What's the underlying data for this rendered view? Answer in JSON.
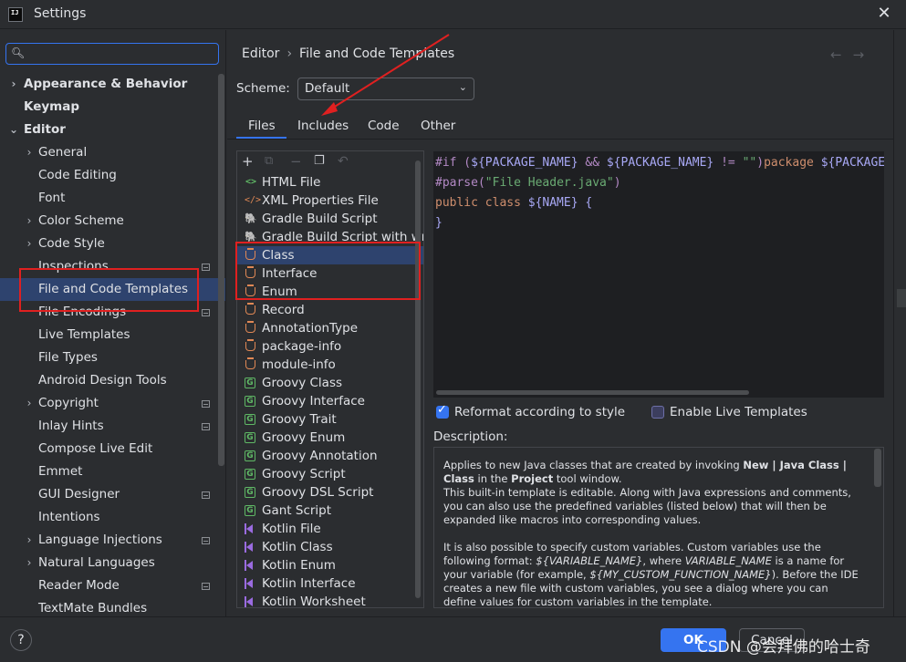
{
  "window": {
    "title": "Settings",
    "app_icon_text": "IJ"
  },
  "sidebar": {
    "search_placeholder": "",
    "items": [
      {
        "label": "Appearance & Behavior",
        "bold": true,
        "chevron": "›",
        "indent": 0
      },
      {
        "label": "Keymap",
        "bold": true,
        "chevron": "",
        "indent": 0
      },
      {
        "label": "Editor",
        "bold": true,
        "chevron": "⌄",
        "indent": 0
      },
      {
        "label": "General",
        "chevron": "›",
        "indent": 1
      },
      {
        "label": "Code Editing",
        "chevron": "",
        "indent": 1
      },
      {
        "label": "Font",
        "chevron": "",
        "indent": 1
      },
      {
        "label": "Color Scheme",
        "chevron": "›",
        "indent": 1
      },
      {
        "label": "Code Style",
        "chevron": "›",
        "indent": 1
      },
      {
        "label": "Inspections",
        "chevron": "",
        "indent": 1,
        "mark": true
      },
      {
        "label": "File and Code Templates",
        "chevron": "",
        "indent": 1,
        "selected": true
      },
      {
        "label": "File Encodings",
        "chevron": "",
        "indent": 1,
        "mark": true
      },
      {
        "label": "Live Templates",
        "chevron": "",
        "indent": 1
      },
      {
        "label": "File Types",
        "chevron": "",
        "indent": 1
      },
      {
        "label": "Android Design Tools",
        "chevron": "",
        "indent": 1
      },
      {
        "label": "Copyright",
        "chevron": "›",
        "indent": 1,
        "mark": true
      },
      {
        "label": "Inlay Hints",
        "chevron": "",
        "indent": 1,
        "mark": true
      },
      {
        "label": "Compose Live Edit",
        "chevron": "",
        "indent": 1
      },
      {
        "label": "Emmet",
        "chevron": "",
        "indent": 1
      },
      {
        "label": "GUI Designer",
        "chevron": "",
        "indent": 1,
        "mark": true
      },
      {
        "label": "Intentions",
        "chevron": "",
        "indent": 1
      },
      {
        "label": "Language Injections",
        "chevron": "›",
        "indent": 1,
        "mark": true
      },
      {
        "label": "Natural Languages",
        "chevron": "›",
        "indent": 1
      },
      {
        "label": "Reader Mode",
        "chevron": "",
        "indent": 1,
        "mark": true
      },
      {
        "label": "TextMate Bundles",
        "chevron": "",
        "indent": 1
      }
    ]
  },
  "breadcrumb": {
    "parent": "Editor",
    "separator": "›",
    "current": "File and Code Templates"
  },
  "nav": {
    "back": "←",
    "forward": "→"
  },
  "scheme": {
    "label": "Scheme:",
    "value": "Default"
  },
  "tabs": [
    {
      "label": "Files",
      "active": true
    },
    {
      "label": "Includes"
    },
    {
      "label": "Code"
    },
    {
      "label": "Other"
    }
  ],
  "toolbar": {
    "add": "+",
    "copy": "⧉",
    "remove": "−",
    "duplicate": "❐",
    "reset": "↶"
  },
  "templates": [
    {
      "name": "HTML File",
      "icon": "html-icon",
      "glyph": "<>"
    },
    {
      "name": "XML Properties File",
      "icon": "xml-icon",
      "glyph": "</>"
    },
    {
      "name": "Gradle Build Script",
      "icon": "gradle-icon",
      "glyph": "🐘"
    },
    {
      "name": "Gradle Build Script with wrapper",
      "icon": "gradle-icon",
      "glyph": "🐘"
    },
    {
      "name": "Class",
      "icon": "java-icon",
      "selected": true
    },
    {
      "name": "Interface",
      "icon": "java-icon"
    },
    {
      "name": "Enum",
      "icon": "java-icon"
    },
    {
      "name": "Record",
      "icon": "java-icon"
    },
    {
      "name": "AnnotationType",
      "icon": "java-icon"
    },
    {
      "name": "package-info",
      "icon": "java-icon"
    },
    {
      "name": "module-info",
      "icon": "java-icon"
    },
    {
      "name": "Groovy Class",
      "icon": "groovy-icon",
      "glyph": "G"
    },
    {
      "name": "Groovy Interface",
      "icon": "groovy-icon",
      "glyph": "G"
    },
    {
      "name": "Groovy Trait",
      "icon": "groovy-icon",
      "glyph": "G"
    },
    {
      "name": "Groovy Enum",
      "icon": "groovy-icon",
      "glyph": "G"
    },
    {
      "name": "Groovy Annotation",
      "icon": "groovy-icon",
      "glyph": "G"
    },
    {
      "name": "Groovy Script",
      "icon": "groovy-icon",
      "glyph": "G"
    },
    {
      "name": "Groovy DSL Script",
      "icon": "groovy-icon",
      "glyph": "G"
    },
    {
      "name": "Gant Script",
      "icon": "groovy-icon",
      "glyph": "G"
    },
    {
      "name": "Kotlin File",
      "icon": "kotlin-icon"
    },
    {
      "name": "Kotlin Class",
      "icon": "kotlin-icon"
    },
    {
      "name": "Kotlin Enum",
      "icon": "kotlin-icon"
    },
    {
      "name": "Kotlin Interface",
      "icon": "kotlin-icon"
    },
    {
      "name": "Kotlin Worksheet",
      "icon": "kotlin-icon"
    }
  ],
  "editor": {
    "lines": [
      [
        {
          "t": "#if (",
          "c": "dir"
        },
        {
          "t": "${PACKAGE_NAME}",
          "c": "var"
        },
        {
          "t": " && ",
          "c": "dir"
        },
        {
          "t": "${PACKAGE_NAME}",
          "c": "var"
        },
        {
          "t": " != ",
          "c": "dir"
        },
        {
          "t": "\"\"",
          "c": "str"
        },
        {
          "t": ")",
          "c": "dir"
        },
        {
          "t": "package ",
          "c": "kw"
        },
        {
          "t": "${PACKAGE_NAME};#end",
          "c": "var"
        }
      ],
      [
        {
          "t": "#parse(",
          "c": "dir"
        },
        {
          "t": "\"File Header.java\"",
          "c": "str"
        },
        {
          "t": ")",
          "c": "dir"
        }
      ],
      [
        {
          "t": "public class ",
          "c": "kw"
        },
        {
          "t": "${NAME}",
          "c": "var"
        },
        {
          "t": " {",
          "c": "var"
        }
      ],
      [
        {
          "t": "}",
          "c": "var"
        }
      ]
    ]
  },
  "options": {
    "reformat_label": "Reformat according to style",
    "reformat_checked": true,
    "live_templates_label": "Enable Live Templates",
    "live_templates_checked": false
  },
  "description": {
    "label": "Description:",
    "p1_a": "Applies to new Java classes that are created by invoking ",
    "p1_b": "New | Java Class | Class",
    "p1_c": " in the ",
    "p1_d": "Project",
    "p1_e": " tool window.",
    "p1_f": "This built-in template is editable. Along with Java expressions and comments, you can also use the predefined variables (listed below) that will then be expanded like macros into corresponding values.",
    "p2_a": "It is also possible to specify custom variables. Custom variables use the following format: ",
    "p2_b": "${VARIABLE_NAME}",
    "p2_c": ", where ",
    "p2_d": "VARIABLE_NAME",
    "p2_e": " is a name for your variable (for example, ",
    "p2_f": "${MY_CUSTOM_FUNCTION_NAME}",
    "p2_g": "). Before the IDE creates a new file with custom variables, you see a dialog where you can define values for custom variables in the template."
  },
  "footer": {
    "help": "?",
    "ok": "OK",
    "cancel": "Cancel",
    "watermark": "CSDN @会拜佛的哈士奇"
  },
  "colors": {
    "accent": "#3574f0",
    "selection": "#2e436e",
    "annotation_red": "#e02020"
  }
}
